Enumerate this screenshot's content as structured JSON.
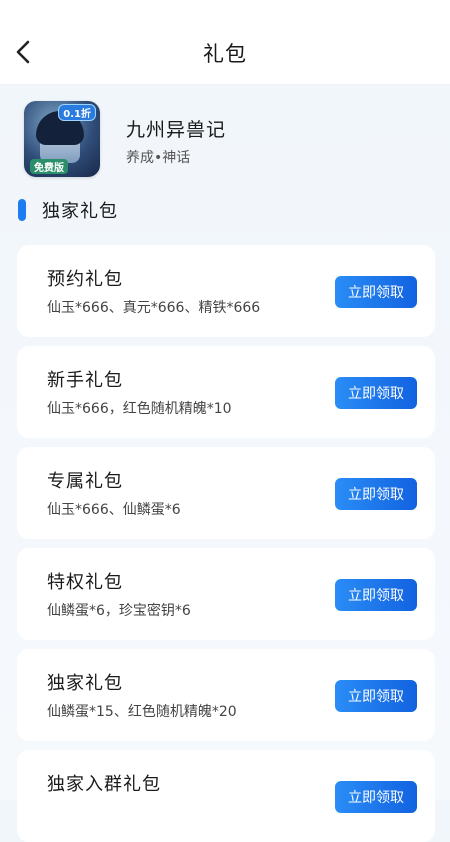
{
  "header": {
    "title": "礼包",
    "back_icon": "chevron-left-icon"
  },
  "game": {
    "name": "九州异兽记",
    "tags": "养成•神话",
    "icon_badge": "0.1折",
    "icon_tag": "免费版"
  },
  "section": {
    "title": "独家礼包",
    "accent": "#1e7cf2"
  },
  "gifts": [
    {
      "title": "预约礼包",
      "desc": "仙玉*666、真元*666、精铁*666",
      "button": "立即领取"
    },
    {
      "title": "新手礼包",
      "desc": "仙玉*666，红色随机精魄*10",
      "button": "立即领取"
    },
    {
      "title": "专属礼包",
      "desc": "仙玉*666、仙鳞蛋*6",
      "button": "立即领取"
    },
    {
      "title": "特权礼包",
      "desc": "仙鳞蛋*6，珍宝密钥*6",
      "button": "立即领取"
    },
    {
      "title": "独家礼包",
      "desc": "仙鳞蛋*15、红色随机精魄*20",
      "button": "立即领取"
    },
    {
      "title": "独家入群礼包",
      "desc": "",
      "button": "立即领取"
    }
  ]
}
